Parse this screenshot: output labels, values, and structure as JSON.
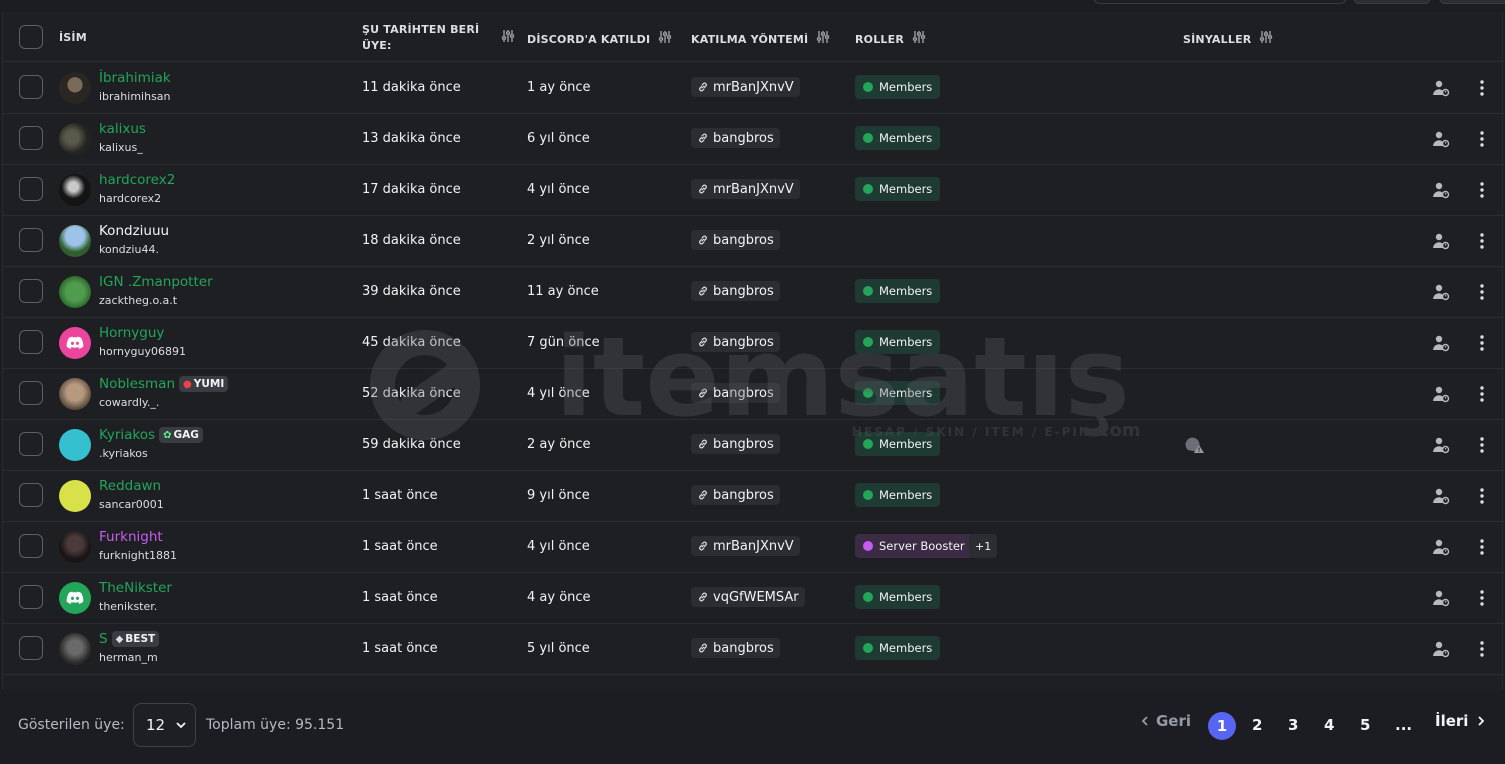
{
  "header": {
    "name": "İSİM",
    "member_since_line1": "ŞU TARİHTEN BERİ",
    "member_since_line2": "ÜYE:",
    "joined_discord": "DİSCORD'A KATILDI",
    "join_method": "KATILMA YÖNTEMİ",
    "roles": "ROLLER",
    "signals": "SİNYALLER"
  },
  "colors": {
    "members_role": "#23a55a",
    "booster_role": "#c75cf0",
    "name_teal": "#23a55a",
    "name_purple": "#c75cf0",
    "accent": "#5865f2"
  },
  "rows": [
    {
      "name": "İbrahimiak",
      "handle": "ibrahimihsan",
      "since": "11 dakika önce",
      "joined": "1 ay önce",
      "invite": "mrBanJXnvV",
      "role": "Members",
      "name_color": "teal"
    },
    {
      "name": "kalixus",
      "handle": "kalixus_",
      "since": "13 dakika önce",
      "joined": "6 yıl önce",
      "invite": "bangbros",
      "role": "Members",
      "name_color": "teal"
    },
    {
      "name": "hardcorex2",
      "handle": "hardcorex2",
      "since": "17 dakika önce",
      "joined": "4 yıl önce",
      "invite": "mrBanJXnvV",
      "role": "Members",
      "name_color": "teal"
    },
    {
      "name": "Kondziuuu",
      "handle": "kondziu44.",
      "since": "18 dakika önce",
      "joined": "2 yıl önce",
      "invite": "bangbros",
      "role": "",
      "name_color": "white"
    },
    {
      "name": "IGN .Zmanpotter",
      "handle": "zacktheg.o.a.t",
      "since": "39 dakika önce",
      "joined": "11 ay önce",
      "invite": "bangbros",
      "role": "Members",
      "name_color": "teal"
    },
    {
      "name": "Hornyguy",
      "handle": "hornyguy06891",
      "since": "45 dakika önce",
      "joined": "7 gün önce",
      "invite": "bangbros",
      "role": "Members",
      "name_color": "teal"
    },
    {
      "name": "Noblesman",
      "tag": "YUMI",
      "handle": "cowardly._.",
      "since": "52 dakika önce",
      "joined": "4 yıl önce",
      "invite": "bangbros",
      "role": "Members",
      "name_color": "teal"
    },
    {
      "name": "Kyriakos",
      "tag": "GAG",
      "handle": ".kyriakos",
      "since": "59 dakika önce",
      "joined": "2 ay önce",
      "invite": "bangbros",
      "role": "Members",
      "name_color": "teal"
    },
    {
      "name": "Reddawn",
      "handle": "sancar0001",
      "since": "1 saat önce",
      "joined": "9 yıl önce",
      "invite": "bangbros",
      "role": "Members",
      "name_color": "teal"
    },
    {
      "name": "Furknight",
      "handle": "furknight1881",
      "since": "1 saat önce",
      "joined": "4 yıl önce",
      "invite": "mrBanJXnvV",
      "role": "Server Booster",
      "extra_roles": "+1",
      "name_color": "purple"
    },
    {
      "name": "TheNikster",
      "handle": "thenikster.",
      "since": "1 saat önce",
      "joined": "4 ay önce",
      "invite": "vqGfWEMSAr",
      "role": "Members",
      "name_color": "teal"
    },
    {
      "name": "S",
      "tag": "BEST",
      "handle": "herman_m",
      "since": "1 saat önce",
      "joined": "5 yıl önce",
      "invite": "bangbros",
      "role": "Members",
      "name_color": "teal"
    }
  ],
  "footer": {
    "shown_label": "Gösterilen üye:",
    "page_size": "12",
    "total": "Toplam üye: 95.151",
    "prev": "Geri",
    "next": "İleri",
    "pages": [
      "1",
      "2",
      "3",
      "4",
      "5",
      "..."
    ],
    "current_page": "1"
  },
  "watermark": {
    "brand": "itemsatış",
    "sub": "HESAP / SKIN / ITEM / E-PIN",
    "suffix": ".com"
  }
}
